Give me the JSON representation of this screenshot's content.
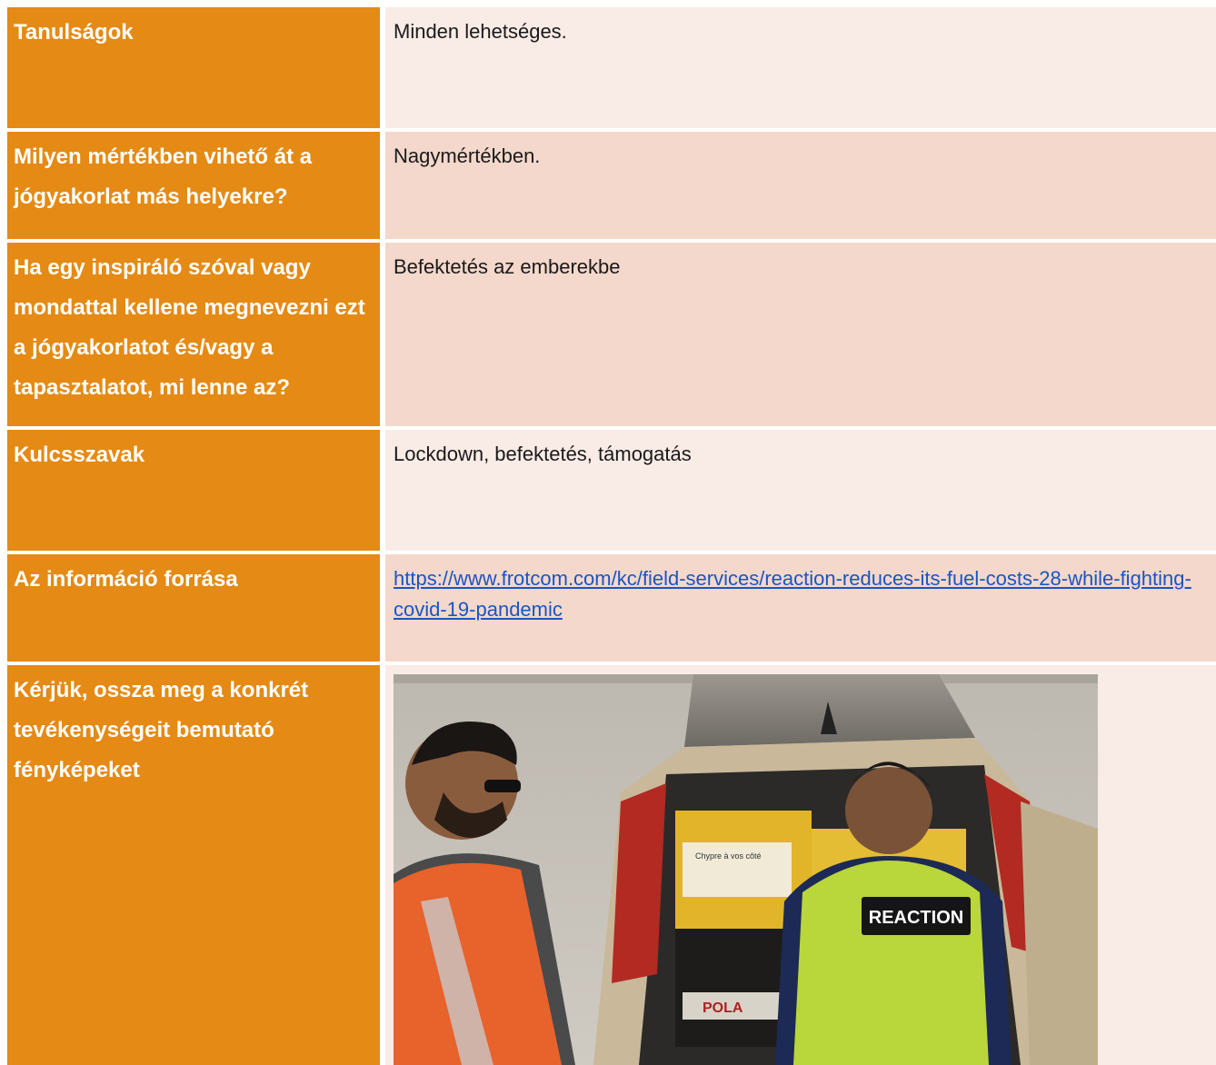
{
  "rows": [
    {
      "label": "Tanulságok",
      "value": "Minden lehetséges."
    },
    {
      "label": "Milyen mértékben vihető át a jógyakorlat más helyekre?",
      "value": "Nagymértékben."
    },
    {
      "label": "Ha egy inspiráló szóval vagy mondattal kellene megnevezni ezt a jógyakorlatot és/vagy a tapasztalatot, mi lenne az?",
      "value": "Befektetés az emberekbe"
    },
    {
      "label": "Kulcsszavak",
      "value": "Lockdown, befektetés, támogatás"
    },
    {
      "label": "Az információ forrása",
      "value": " https://www.frotcom.com/kc/field-services/reaction-reduces-its-fuel-costs-28-while-fighting-covid-19-pandemic"
    },
    {
      "label": "Kérjük, ossza meg a konkrét tevékenységeit bemutató fényképeket"
    }
  ],
  "photo": {
    "vest_text": "REACTION",
    "box_text": "Chypre à vos côté",
    "box_brand": "POLA"
  },
  "colors": {
    "label_bg": "#e58a14",
    "value_light": "#f9ebe5",
    "value_dark": "#f4d8cb",
    "link": "#1a55c4"
  }
}
